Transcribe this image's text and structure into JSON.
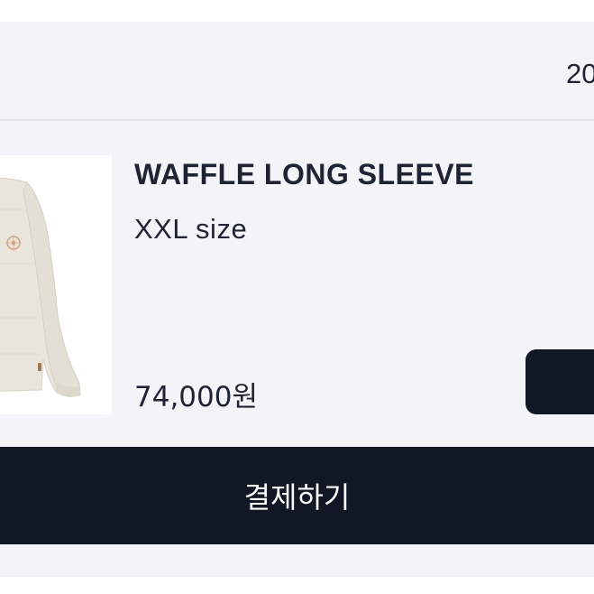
{
  "order": {
    "date_partial": "20"
  },
  "product": {
    "image_icon": "sweater-thumbnail-icon",
    "name": "WAFFLE LONG SLEEVE",
    "option": "XXL size",
    "price": "74,000원"
  },
  "actions": {
    "side_button_label": "",
    "pay_label": "결제하기"
  },
  "colors": {
    "card_background": "#f3f4f7",
    "primary_dark": "#121726",
    "text_primary": "#1e2433",
    "divider": "#dfe1e6",
    "thumbnail_background": "#ffffff",
    "sweater": "#e9e5dc",
    "emblem": "#d6a383"
  }
}
